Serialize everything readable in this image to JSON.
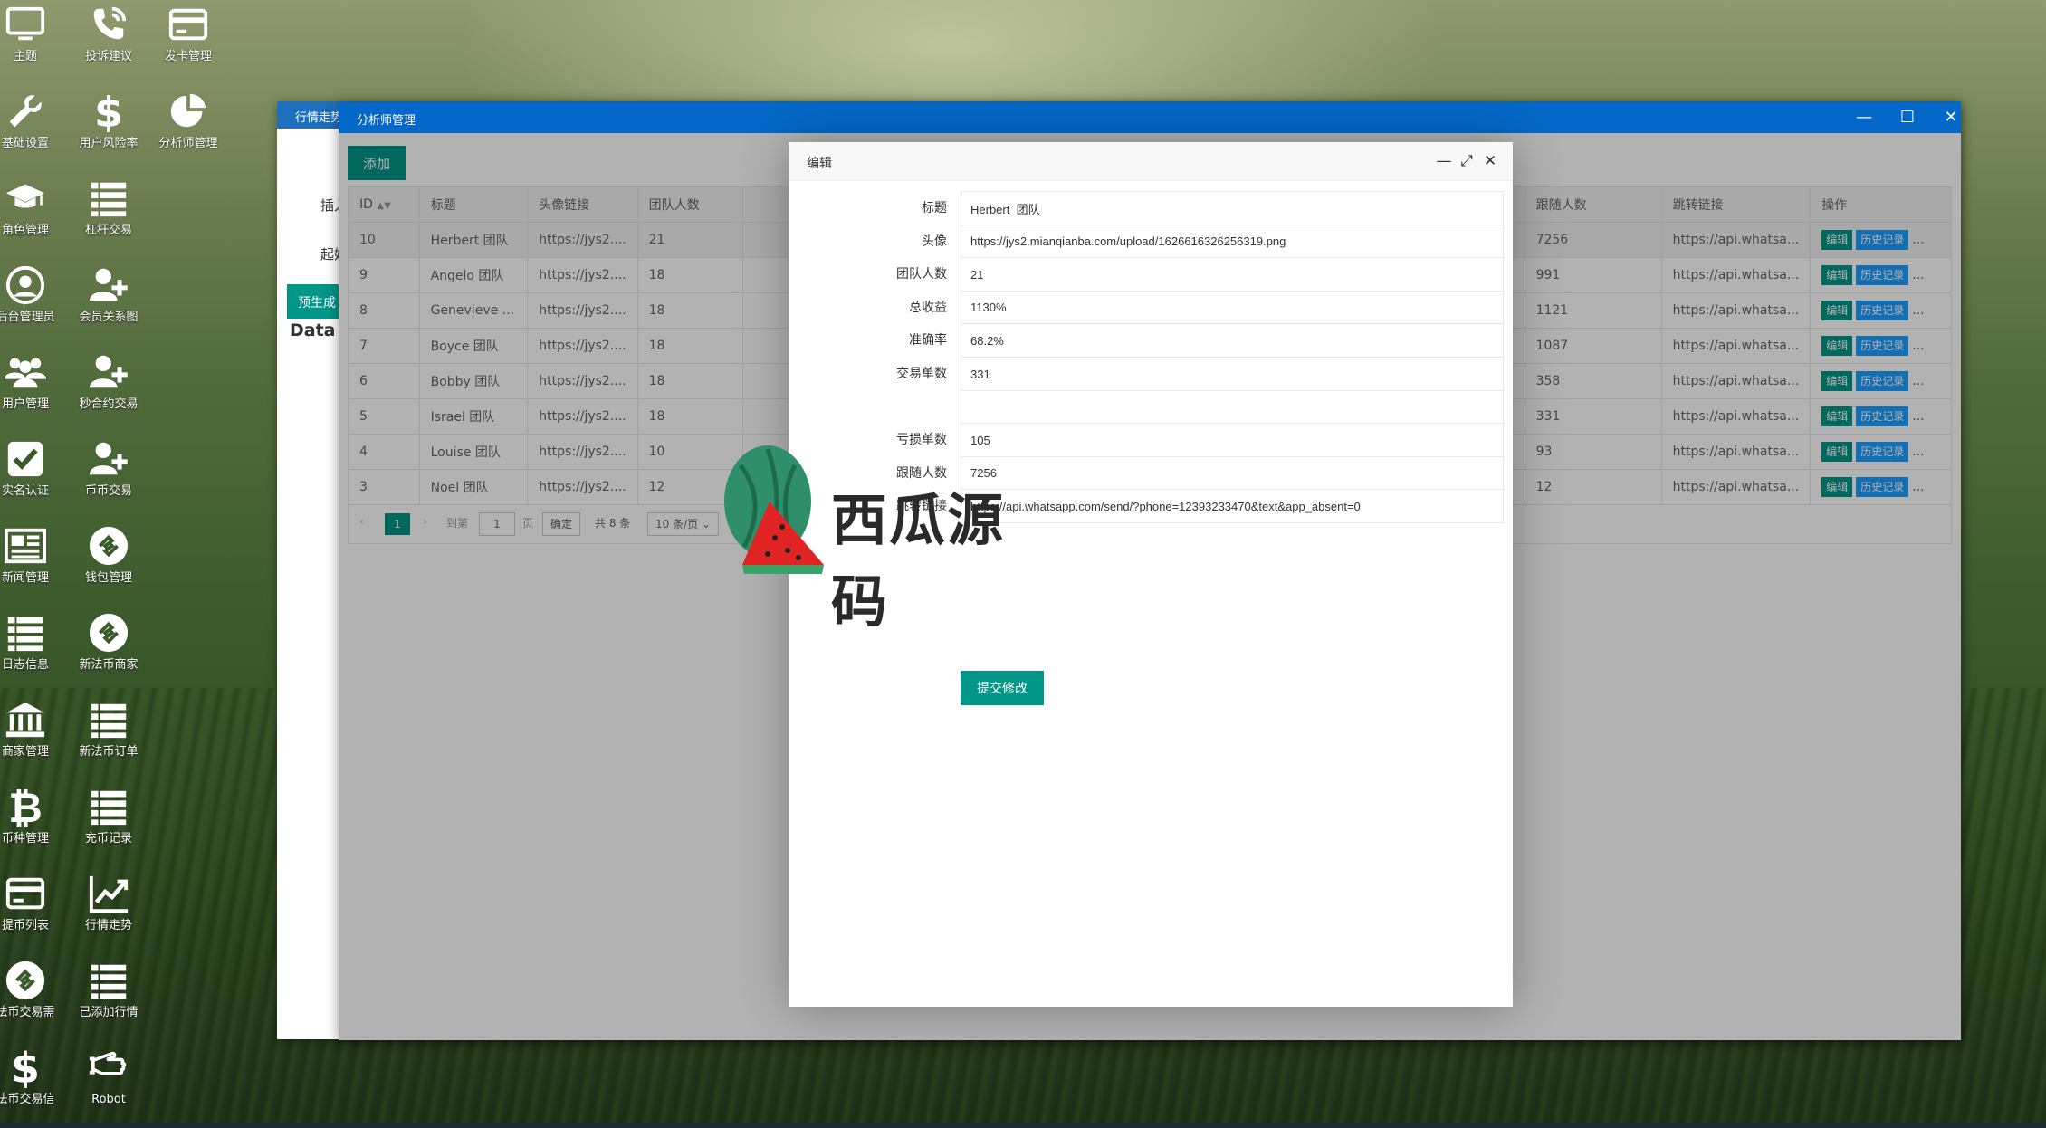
{
  "desktop": {
    "icons": [
      {
        "label": "主题",
        "icon": "monitor-icon"
      },
      {
        "label": "投诉建议",
        "icon": "phone-icon"
      },
      {
        "label": "发卡管理",
        "icon": "card-icon"
      },
      {
        "label": "基础设置",
        "icon": "wrench-icon"
      },
      {
        "label": "用户风险率",
        "icon": "dollar-icon"
      },
      {
        "label": "分析师管理",
        "icon": "pie-icon"
      },
      {
        "label": "角色管理",
        "icon": "graduation-cap-icon"
      },
      {
        "label": "杠杆交易",
        "icon": "list-icon"
      },
      {
        "label": "后台管理员",
        "icon": "user-circle-icon"
      },
      {
        "label": "会员关系图",
        "icon": "user-plus-icon"
      },
      {
        "label": "用户管理",
        "icon": "users-icon"
      },
      {
        "label": "秒合约交易",
        "icon": "user-plus-icon"
      },
      {
        "label": "实名认证",
        "icon": "check-square-icon"
      },
      {
        "label": "币币交易",
        "icon": "user-plus-icon"
      },
      {
        "label": "新闻管理",
        "icon": "newspaper-icon"
      },
      {
        "label": "钱包管理",
        "icon": "diamond-link-icon"
      },
      {
        "label": "日志信息",
        "icon": "list-icon"
      },
      {
        "label": "新法币商家",
        "icon": "diamond-link-icon"
      },
      {
        "label": "商家管理",
        "icon": "bank-icon"
      },
      {
        "label": "新法币订单",
        "icon": "list-icon"
      },
      {
        "label": "币种管理",
        "icon": "bitcoin-icon"
      },
      {
        "label": "充币记录",
        "icon": "list-icon"
      },
      {
        "label": "提币列表",
        "icon": "card-icon"
      },
      {
        "label": "行情走势",
        "icon": "line-chart-icon"
      },
      {
        "label": "法币交易需",
        "icon": "diamond-link-icon"
      },
      {
        "label": "已添加行情",
        "icon": "list-icon"
      },
      {
        "label": "法币交易信",
        "icon": "dollar-icon"
      },
      {
        "label": "Robot",
        "icon": "hand-icon"
      }
    ]
  },
  "back_window": {
    "title": "行情走势",
    "label_1": "插入",
    "label_2": "起始",
    "button": "预生成",
    "data_text": "Data A"
  },
  "main_window": {
    "title": "分析师管理",
    "add_button": "添加",
    "columns": [
      "ID",
      "标题",
      "头像链接",
      "团队人数",
      "跟随人数",
      "跳转链接",
      "操作"
    ],
    "rows": [
      {
        "id": "10",
        "title": "Herbert 团队",
        "avatar": "https://jys2....",
        "team": "21",
        "followers": "7256",
        "link": "https://api.whatsa..."
      },
      {
        "id": "9",
        "title": "Angelo 团队",
        "avatar": "https://jys2....",
        "team": "18",
        "followers": "991",
        "link": "https://api.whatsa..."
      },
      {
        "id": "8",
        "title": "Genevieve ...",
        "avatar": "https://jys2....",
        "team": "18",
        "followers": "1121",
        "link": "https://api.whatsa..."
      },
      {
        "id": "7",
        "title": "Boyce 团队",
        "avatar": "https://jys2....",
        "team": "18",
        "followers": "1087",
        "link": "https://api.whatsa..."
      },
      {
        "id": "6",
        "title": "Bobby 团队",
        "avatar": "https://jys2....",
        "team": "18",
        "followers": "358",
        "link": "https://api.whatsa..."
      },
      {
        "id": "5",
        "title": "Israel 团队",
        "avatar": "https://jys2....",
        "team": "18",
        "followers": "331",
        "link": "https://api.whatsa..."
      },
      {
        "id": "4",
        "title": "Louise 团队",
        "avatar": "https://jys2....",
        "team": "10",
        "followers": "93",
        "link": "https://api.whatsa..."
      },
      {
        "id": "3",
        "title": "Noel 团队",
        "avatar": "https://jys2....",
        "team": "12",
        "followers": "12",
        "link": "https://api.whatsa..."
      }
    ],
    "op_edit": "编辑",
    "op_history": "历史记录",
    "op_more": "...",
    "pager": {
      "current": "1",
      "goto": "到第",
      "page_input": "1",
      "page_unit": "页",
      "confirm": "确定",
      "total": "共 8 条",
      "page_size": "10 条/页"
    }
  },
  "modal": {
    "title": "编辑",
    "fields": [
      {
        "label": "标题",
        "value": "Herbert  团队"
      },
      {
        "label": "头像",
        "value": "https://jys2.mianqianba.com/upload/1626616326256319.png"
      },
      {
        "label": "团队人数",
        "value": "21"
      },
      {
        "label": "总收益",
        "value": "1130%"
      },
      {
        "label": "准确率",
        "value": "68.2%"
      },
      {
        "label": "交易单数",
        "value": "331"
      },
      {
        "label": "",
        "value": ""
      },
      {
        "label": "亏损单数",
        "value": "105"
      },
      {
        "label": "跟随人数",
        "value": "7256"
      },
      {
        "label": "跳转链接",
        "value": "https://api.whatsapp.com/send/?phone=12393233470&text&app_absent=0"
      }
    ],
    "submit": "提交修改"
  },
  "watermark": {
    "text": "西瓜源码"
  }
}
